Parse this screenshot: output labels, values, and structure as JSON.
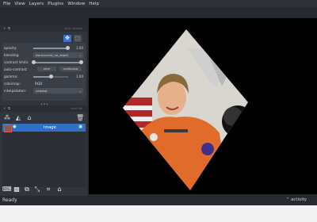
{
  "menu": [
    "File",
    "View",
    "Layers",
    "Plugins",
    "Window",
    "Help"
  ],
  "panel_title": "layer controls",
  "controls": {
    "opacity": {
      "label": "opacity:",
      "value": "1.00",
      "fraction": 1.0
    },
    "blending": {
      "label": "blending:",
      "value": "translucent_no_depth"
    },
    "contrast": {
      "label": "contrast limits:"
    },
    "auto_contrast": {
      "label": "auto-contrast:",
      "once": "once",
      "continuous": "continuous"
    },
    "gamma": {
      "label": "gamma:",
      "value": "1.00",
      "fraction": 0.5
    },
    "colormap": {
      "label": "colormap:",
      "value": "RGB"
    },
    "interpolation": {
      "label": "interpolation:",
      "value": "nearest"
    }
  },
  "layer_list_title": "layer list",
  "layers": [
    {
      "name": "Image",
      "selected": true
    }
  ],
  "status": {
    "left": "Ready",
    "right": "activity"
  }
}
